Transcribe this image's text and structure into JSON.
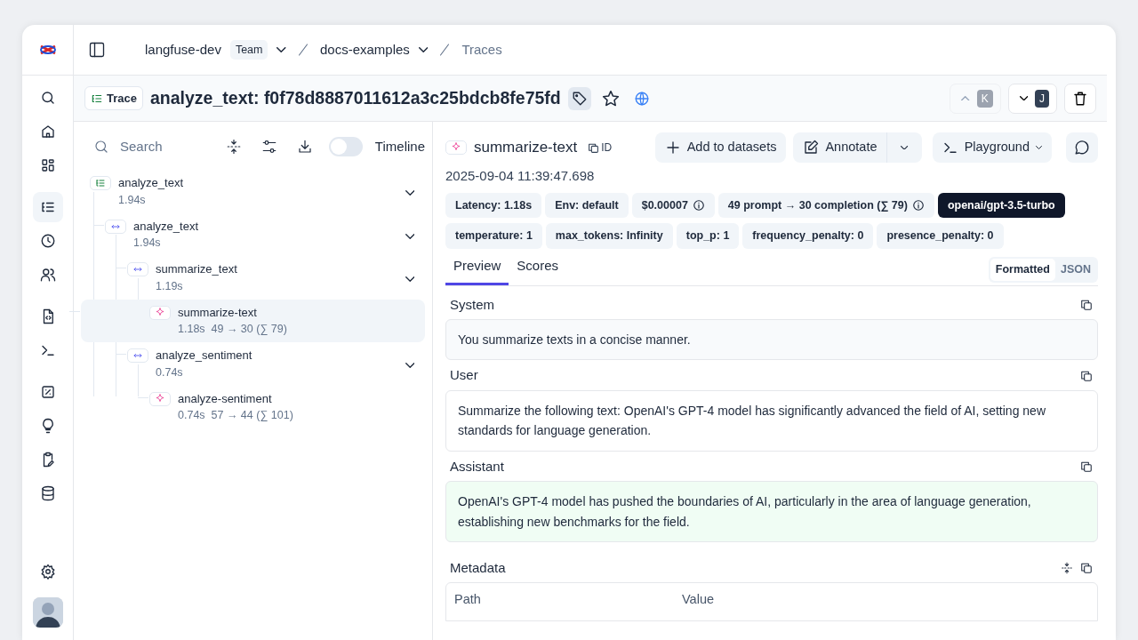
{
  "breadcrumb": {
    "organization": "langfuse-dev",
    "plan": "Team",
    "project": "docs-examples",
    "page": "Traces"
  },
  "sidebar": {
    "groups": [
      [
        {
          "kind": "search",
          "selected": false
        },
        {
          "kind": "home",
          "selected": false
        },
        {
          "kind": "dashboard",
          "selected": false
        }
      ],
      [
        {
          "kind": "traces",
          "selected": true
        },
        {
          "kind": "clock",
          "selected": false
        },
        {
          "kind": "users",
          "selected": false
        }
      ],
      [
        {
          "kind": "file-code",
          "selected": false
        },
        {
          "kind": "terminal",
          "selected": false
        }
      ],
      [
        {
          "kind": "percent",
          "selected": false
        },
        {
          "kind": "bulb",
          "selected": false
        },
        {
          "kind": "clipboard",
          "selected": false
        },
        {
          "kind": "database",
          "selected": false
        }
      ]
    ],
    "footer": [
      {
        "kind": "settings",
        "selected": false
      }
    ]
  },
  "trace_header": {
    "badge": "Trace",
    "title": "analyze_text: f0f78d8887011612a3c25bdcb8fe75fd",
    "starred": false,
    "public": true,
    "navigation": [
      {
        "kind": "previous",
        "key": "K",
        "disabled": true
      },
      {
        "kind": "next",
        "key": "J",
        "disabled": false
      }
    ]
  },
  "tree": {
    "search": {
      "placeholder": "Search"
    },
    "timeline": {
      "label": "Timeline",
      "on": false
    },
    "nodes": [
      {
        "kind": "trace",
        "name": "analyze_text",
        "meta": "1.94s",
        "selected": false,
        "expanded": true,
        "children": [
          {
            "kind": "span",
            "name": "analyze_text",
            "meta": "1.94s",
            "selected": false,
            "expanded": true,
            "children": [
              {
                "kind": "span",
                "name": "summarize_text",
                "meta": "1.19s",
                "selected": false,
                "expanded": true,
                "children": [
                  {
                    "kind": "generation",
                    "name": "summarize-text",
                    "meta": "1.18s  49 → 30 (∑ 79)",
                    "selected": true
                  }
                ]
              },
              {
                "kind": "span",
                "name": "analyze_sentiment",
                "meta": "0.74s",
                "selected": false,
                "expanded": true,
                "children": [
                  {
                    "kind": "generation",
                    "name": "analyze-sentiment",
                    "meta": "0.74s  57 → 44 (∑ 101)",
                    "selected": false
                  }
                ]
              }
            ]
          }
        ]
      }
    ]
  },
  "detail": {
    "kind": "generation",
    "title": "summarize-text",
    "id_label": "ID",
    "actions": [
      {
        "kind": "add",
        "label": "Add to datasets"
      },
      {
        "kind": "annotate",
        "label": "Annotate"
      },
      {
        "kind": "playground",
        "label": "Playground"
      },
      {
        "kind": "comment"
      }
    ],
    "timestamp": "2025-09-04 11:39:47.698",
    "badge_rows": [
      [
        {
          "kind": "plain",
          "text": "Latency: 1.18s",
          "info": false
        },
        {
          "kind": "plain",
          "text": "Env: default",
          "info": false
        },
        {
          "kind": "plain",
          "text": "$0.00007",
          "info": true
        },
        {
          "kind": "plain",
          "text": "49 prompt → 30 completion (∑ 79)",
          "info": true
        },
        {
          "kind": "model",
          "text": "openai/gpt-3.5-turbo",
          "info": false
        }
      ],
      [
        {
          "kind": "plain",
          "text": "temperature: 1",
          "info": false
        },
        {
          "kind": "plain",
          "text": "max_tokens: Infinity",
          "info": false
        },
        {
          "kind": "plain",
          "text": "top_p: 1",
          "info": false
        },
        {
          "kind": "plain",
          "text": "frequency_penalty: 0",
          "info": false
        },
        {
          "kind": "plain",
          "text": "presence_penalty: 0",
          "info": false
        }
      ]
    ],
    "tabs": [
      {
        "label": "Preview",
        "selected": true
      },
      {
        "label": "Scores",
        "selected": false
      }
    ],
    "view_modes": [
      {
        "label": "Formatted",
        "selected": true
      },
      {
        "label": "JSON",
        "selected": false
      }
    ],
    "messages": [
      {
        "kind": "system",
        "role": "System",
        "content": "You summarize texts in a concise manner."
      },
      {
        "kind": "user",
        "role": "User",
        "content": "Summarize the following text: OpenAI's GPT-4 model has significantly advanced the field of AI, setting new standards for language generation."
      },
      {
        "kind": "assistant",
        "role": "Assistant",
        "content": "OpenAI's GPT-4 model has pushed the boundaries of AI, particularly in the area of language generation, establishing new benchmarks for the field."
      }
    ],
    "metadata": {
      "title": "Metadata",
      "columns": [
        "Path",
        "Value"
      ]
    }
  }
}
